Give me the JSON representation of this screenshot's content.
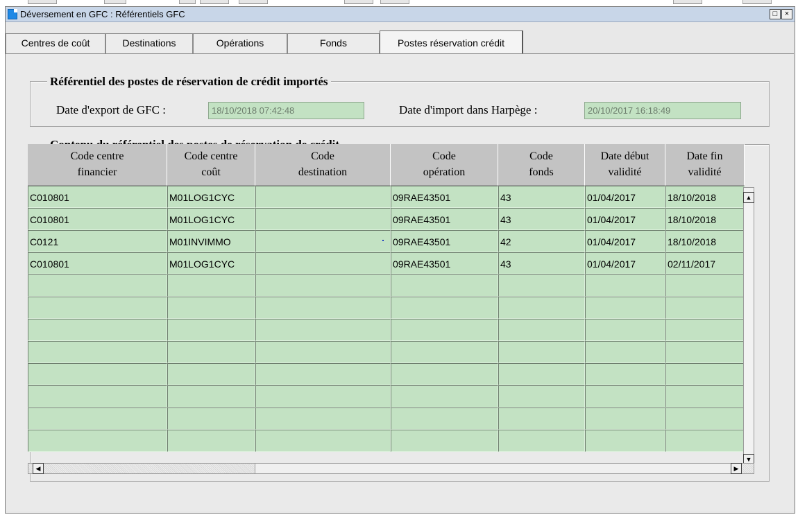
{
  "window": {
    "title": "Déversement en GFC : Référentiels GFC"
  },
  "tabs": [
    {
      "label": "Centres de coût"
    },
    {
      "label": "Destinations"
    },
    {
      "label": "Opérations"
    },
    {
      "label": "Fonds"
    },
    {
      "label": "Postes réservation crédit",
      "active": true
    }
  ],
  "import_group": {
    "title": "Référentiel des postes de réservation de crédit importés",
    "export_label": "Date d'export de GFC :",
    "export_value": "18/10/2018 07:42:48",
    "import_label": "Date d'import dans Harpège :",
    "import_value": "20/10/2017 16:18:49"
  },
  "content_group": {
    "title": "Contenu du référentiel des postes de réservation de crédit"
  },
  "grid": {
    "headers": [
      {
        "line1": "Code centre",
        "line2": "financier"
      },
      {
        "line1": "Code centre",
        "line2": "coût"
      },
      {
        "line1": "Code",
        "line2": "destination"
      },
      {
        "line1": "Code",
        "line2": "opération"
      },
      {
        "line1": "Code",
        "line2": "fonds"
      },
      {
        "line1": "Date début",
        "line2": "validité"
      },
      {
        "line1": "Date fin",
        "line2": "validité"
      }
    ],
    "rows": [
      [
        "C010801",
        "M01LOG1CYC",
        "",
        "09RAE43501",
        "43",
        "01/04/2017",
        "18/10/2018"
      ],
      [
        "C010801",
        "M01LOG1CYC",
        "",
        "09RAE43501",
        "43",
        "01/04/2017",
        "18/10/2018"
      ],
      [
        "C0121",
        "M01INVIMMO",
        "",
        "09RAE43501",
        "42",
        "01/04/2017",
        "18/10/2018"
      ],
      [
        "C010801",
        "M01LOG1CYC",
        "",
        "09RAE43501",
        "43",
        "01/04/2017",
        "02/11/2017"
      ],
      [
        "",
        "",
        "",
        "",
        "",
        "",
        ""
      ],
      [
        "",
        "",
        "",
        "",
        "",
        "",
        ""
      ],
      [
        "",
        "",
        "",
        "",
        "",
        "",
        ""
      ],
      [
        "",
        "",
        "",
        "",
        "",
        "",
        ""
      ],
      [
        "",
        "",
        "",
        "",
        "",
        "",
        ""
      ],
      [
        "",
        "",
        "",
        "",
        "",
        "",
        ""
      ],
      [
        "",
        "",
        "",
        "",
        "",
        "",
        ""
      ],
      [
        "",
        "",
        "",
        "",
        "",
        "",
        ""
      ]
    ]
  },
  "icons": {
    "window_icon": "app-window-icon",
    "maximize": "maximize-icon",
    "close": "close-icon",
    "scroll_up": "arrow-up-icon",
    "scroll_down": "arrow-down-icon",
    "scroll_left": "arrow-left-icon",
    "scroll_right": "arrow-right-icon"
  },
  "colors": {
    "field_bg": "#c3e2c3",
    "header_bg": "#c3c3c3",
    "panel_bg": "#eaeaea",
    "titlebar_bg": "#c8d6e8"
  }
}
